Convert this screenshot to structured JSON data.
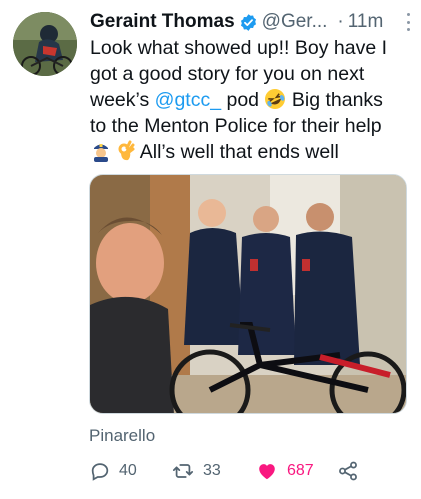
{
  "author": {
    "name": "Geraint Thomas",
    "handle": "@Ger...",
    "separator": "·",
    "time": "11m"
  },
  "tweet": {
    "line1": "Look what showed up!! Boy have I",
    "line2": "got a good story for you on next",
    "line3_a": "week’s ",
    "mention": "@gtcc_",
    "line3_b": " pod ",
    "line3_c": " Big thanks",
    "line4": "to the Menton Police for their help",
    "line5": " All’s well that ends well"
  },
  "media": {
    "location": "Pinarello"
  },
  "actions": {
    "replies": "40",
    "retweets": "33",
    "likes": "687"
  },
  "colors": {
    "link": "#1d9bf0",
    "like": "#f91880",
    "muted": "#536471"
  },
  "icons": [
    "verified-badge-icon",
    "more-icon",
    "reply-icon",
    "retweet-icon",
    "heart-icon",
    "share-icon",
    "rofl-emoji",
    "police-officer-emoji",
    "ok-hand-emoji"
  ]
}
